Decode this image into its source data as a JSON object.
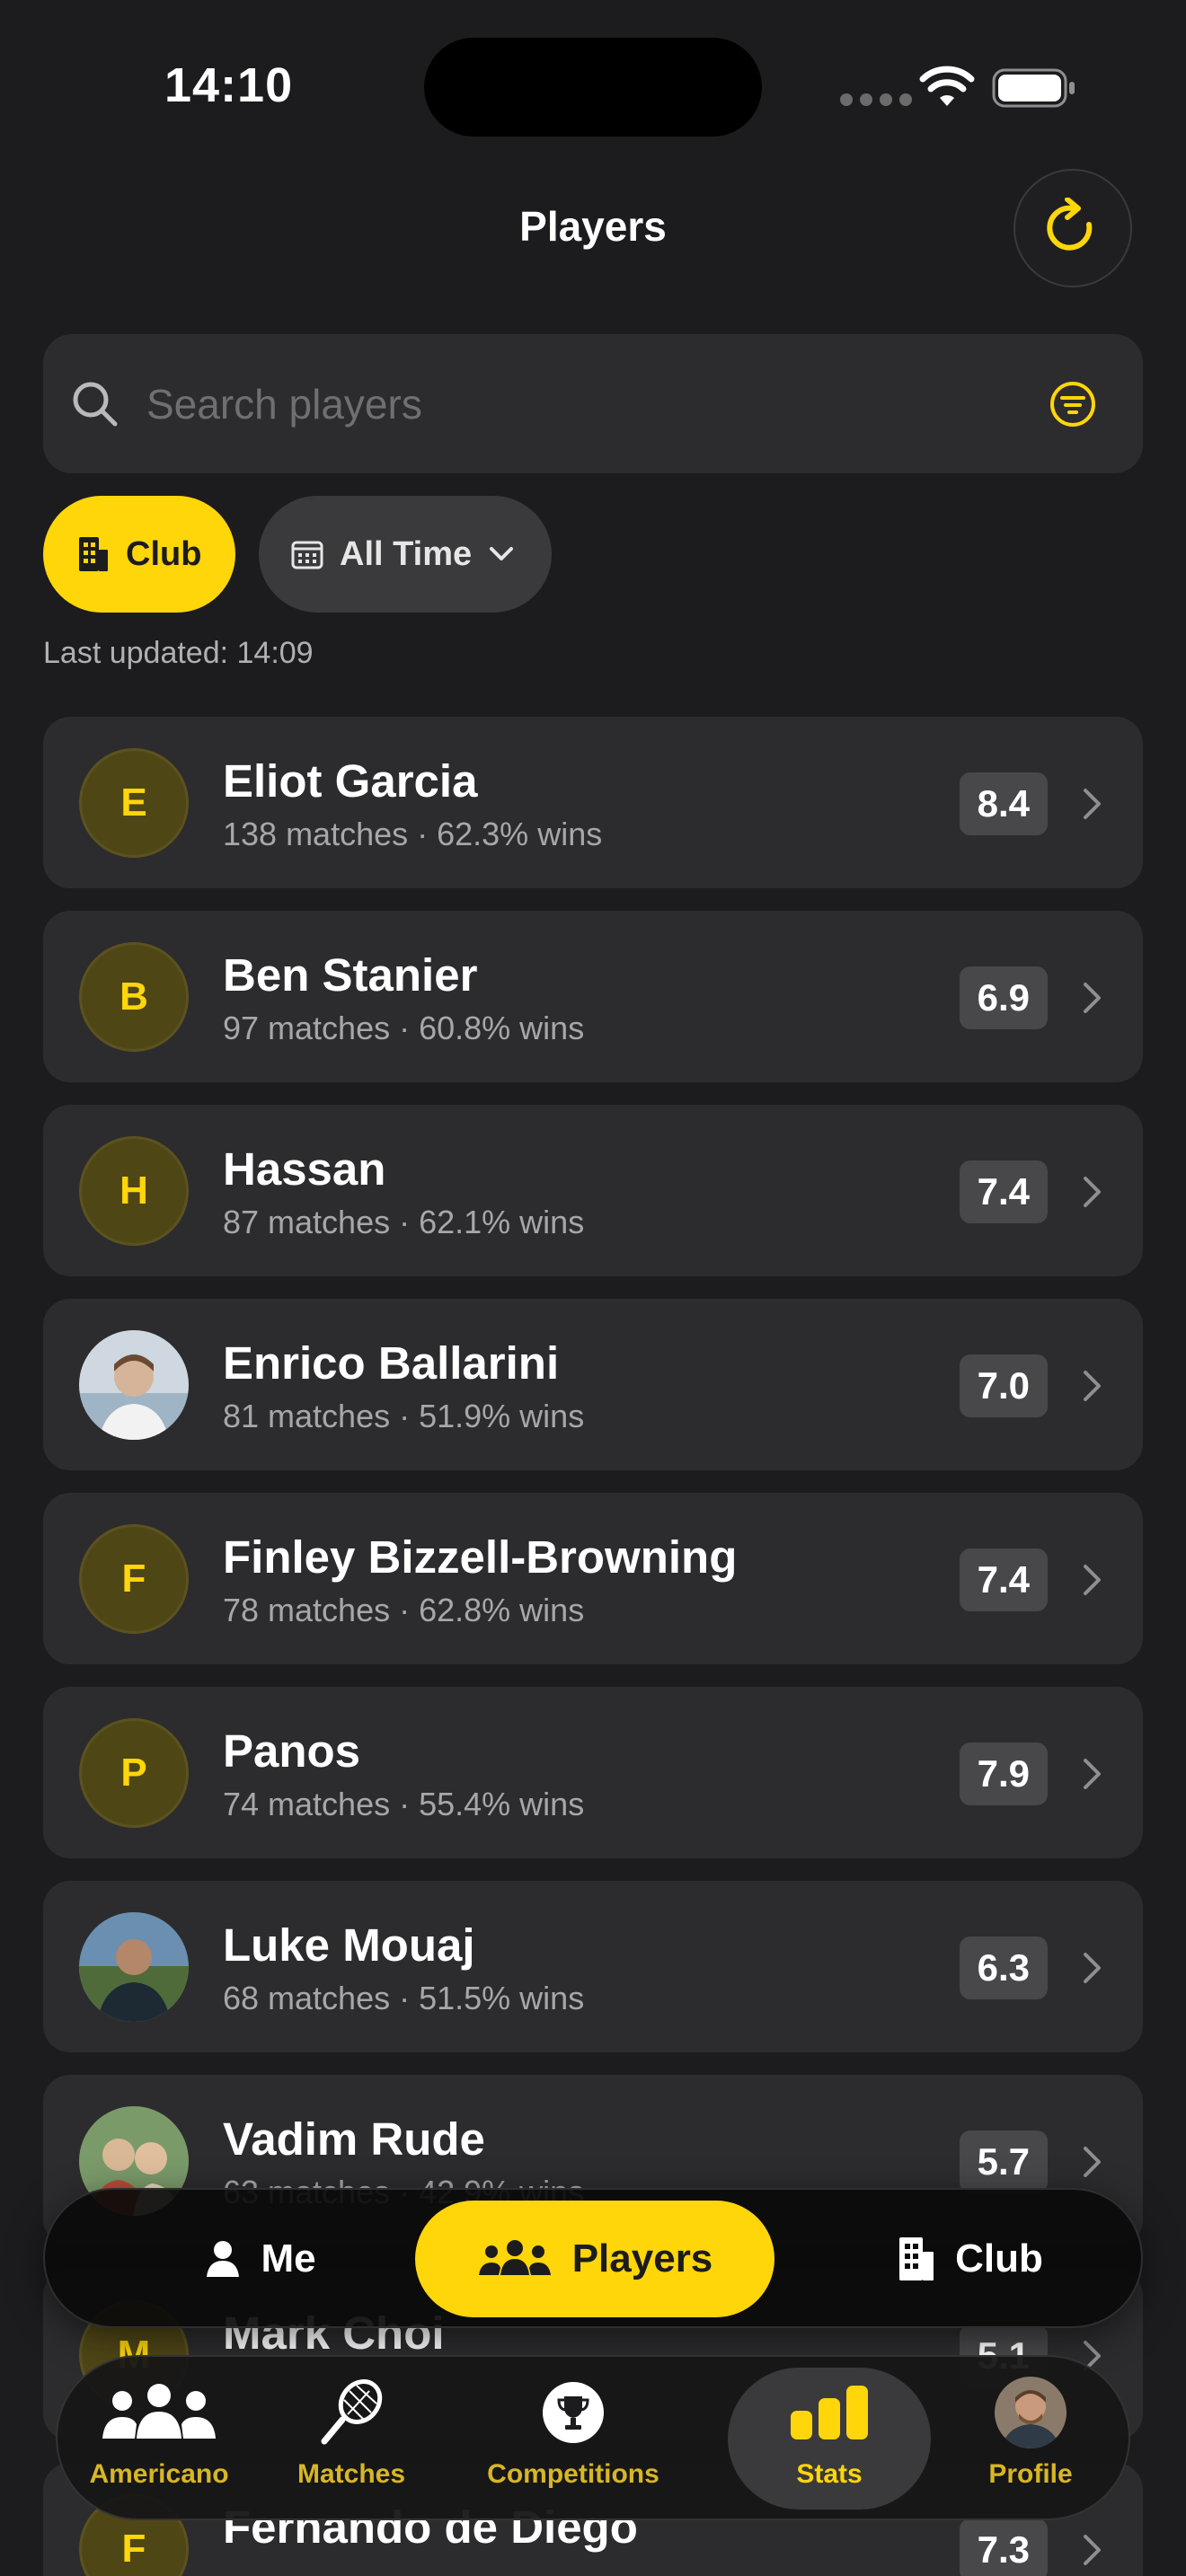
{
  "status_bar": {
    "time": "14:10"
  },
  "header": {
    "title": "Players"
  },
  "search": {
    "placeholder": "Search players"
  },
  "chips": {
    "club": "Club",
    "period": "All Time"
  },
  "last_updated": "Last updated: 14:09",
  "players": [
    {
      "name": "Eliot Garcia",
      "stats": "138 matches · 62.3% wins",
      "rating": "8.4",
      "initial": "E"
    },
    {
      "name": "Ben Stanier",
      "stats": "97 matches · 60.8% wins",
      "rating": "6.9",
      "initial": "B"
    },
    {
      "name": "Hassan",
      "stats": "87 matches · 62.1% wins",
      "rating": "7.4",
      "initial": "H"
    },
    {
      "name": "Enrico Ballarini",
      "stats": "81 matches · 51.9% wins",
      "rating": "7.0",
      "initial": ""
    },
    {
      "name": "Finley Bizzell-Browning",
      "stats": "78 matches · 62.8% wins",
      "rating": "7.4",
      "initial": "F"
    },
    {
      "name": "Panos",
      "stats": "74 matches · 55.4% wins",
      "rating": "7.9",
      "initial": "P"
    },
    {
      "name": "Luke Mouaj",
      "stats": "68 matches · 51.5% wins",
      "rating": "6.3",
      "initial": ""
    },
    {
      "name": "Vadim Rude",
      "stats": "63 matches · 42.9% wins",
      "rating": "5.7",
      "initial": ""
    },
    {
      "name": "Mark Choi",
      "stats": "",
      "rating": "5.1",
      "initial": "M"
    },
    {
      "name": "Fernando de Diego",
      "stats": "",
      "rating": "7.3",
      "initial": "F"
    }
  ],
  "segment": {
    "me": "Me",
    "players": "Players",
    "club": "Club"
  },
  "tabs": {
    "americano": "Americano",
    "matches": "Matches",
    "competitions": "Competitions",
    "stats": "Stats",
    "profile": "Profile"
  },
  "colors": {
    "accent": "#ffd60a",
    "background": "#1c1c1e",
    "card": "#2c2c2e"
  },
  "icons": [
    "search-icon",
    "filter-icon",
    "refresh-icon",
    "building-icon",
    "calendar-icon",
    "chevron-down-icon",
    "chevron-right-icon",
    "person-icon",
    "people-icon",
    "racket-icon",
    "trophy-icon",
    "bar-chart-icon"
  ]
}
